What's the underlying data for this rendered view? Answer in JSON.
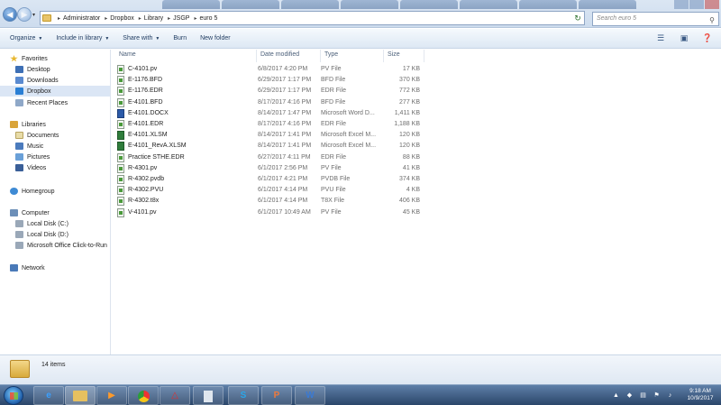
{
  "address": {
    "crumbs": [
      "Administrator",
      "Dropbox",
      "Library",
      "JSGP",
      "euro 5"
    ],
    "search_placeholder": "Search euro 5"
  },
  "toolbar": {
    "organize": "Organize",
    "include": "Include in library",
    "share": "Share with",
    "burn": "Burn",
    "new_folder": "New folder"
  },
  "nav": {
    "favorites": "Favorites",
    "desktop": "Desktop",
    "downloads": "Downloads",
    "dropbox": "Dropbox",
    "recent": "Recent Places",
    "libraries": "Libraries",
    "documents": "Documents",
    "music": "Music",
    "pictures": "Pictures",
    "videos": "Videos",
    "homegroup": "Homegroup",
    "computer": "Computer",
    "disk_c": "Local Disk (C:)",
    "disk_d": "Local Disk (D:)",
    "office": "Microsoft Office Click-to-Run",
    "network": "Network"
  },
  "columns": {
    "name": "Name",
    "date": "Date modified",
    "type": "Type",
    "size": "Size"
  },
  "files": [
    {
      "name": "C-4101.pv",
      "date": "6/8/2017 4:20 PM",
      "type": "PV File",
      "size": "17 KB"
    },
    {
      "name": "E-1176.BFD",
      "date": "6/29/2017 1:17 PM",
      "type": "BFD File",
      "size": "370 KB"
    },
    {
      "name": "E-1176.EDR",
      "date": "6/29/2017 1:17 PM",
      "type": "EDR File",
      "size": "772 KB"
    },
    {
      "name": "E-4101.BFD",
      "date": "8/17/2017 4:16 PM",
      "type": "BFD File",
      "size": "277 KB"
    },
    {
      "name": "E-4101.DOCX",
      "date": "8/14/2017 1:47 PM",
      "type": "Microsoft Word D...",
      "size": "1,411 KB"
    },
    {
      "name": "E-4101.EDR",
      "date": "8/17/2017 4:16 PM",
      "type": "EDR File",
      "size": "1,188 KB"
    },
    {
      "name": "E-4101.XLSM",
      "date": "8/14/2017 1:41 PM",
      "type": "Microsoft Excel M...",
      "size": "120 KB"
    },
    {
      "name": "E-4101_RevA.XLSM",
      "date": "8/14/2017 1:41 PM",
      "type": "Microsoft Excel M...",
      "size": "120 KB"
    },
    {
      "name": "Practice STHE.EDR",
      "date": "6/27/2017 4:11 PM",
      "type": "EDR File",
      "size": "88 KB"
    },
    {
      "name": "R-4301.pv",
      "date": "6/1/2017 2:56 PM",
      "type": "PV File",
      "size": "41 KB"
    },
    {
      "name": "R-4302.pvdb",
      "date": "6/1/2017 4:21 PM",
      "type": "PVDB File",
      "size": "374 KB"
    },
    {
      "name": "R-4302.PVU",
      "date": "6/1/2017 4:14 PM",
      "type": "PVU File",
      "size": "4 KB"
    },
    {
      "name": "R-4302.t8x",
      "date": "6/1/2017 4:14 PM",
      "type": "T8X File",
      "size": "406 KB"
    },
    {
      "name": "V-4101.pv",
      "date": "6/1/2017 10:49 AM",
      "type": "PV File",
      "size": "45 KB"
    }
  ],
  "details": {
    "count": "14 items"
  },
  "taskbar": {
    "time": "9:18 AM",
    "date": "10/9/2017"
  }
}
